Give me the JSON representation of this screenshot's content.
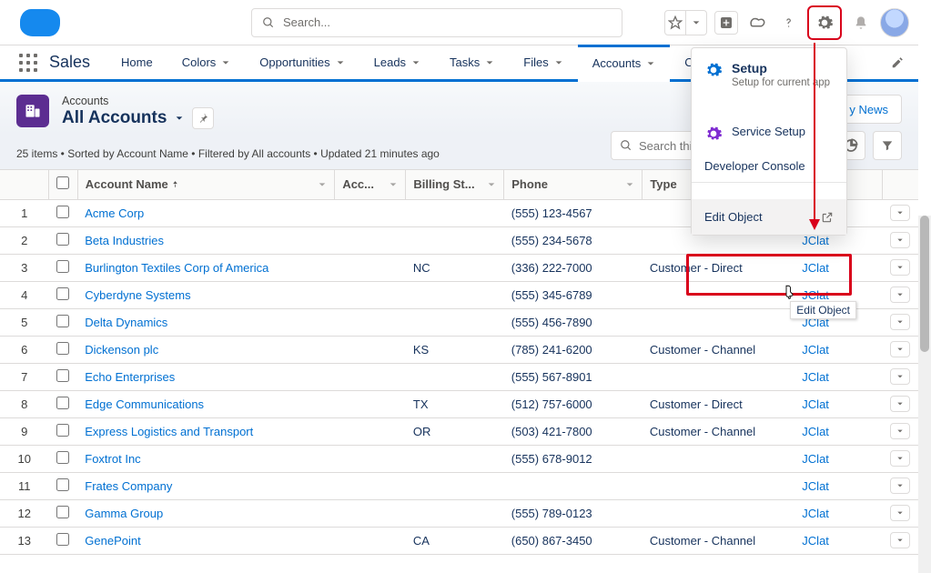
{
  "header": {
    "search_placeholder": "Search..."
  },
  "nav": {
    "app_name": "Sales",
    "items": [
      "Home",
      "Colors",
      "Opportunities",
      "Leads",
      "Tasks",
      "Files",
      "Accounts",
      "C"
    ],
    "active_index": 6
  },
  "page_header": {
    "object_label": "Accounts",
    "listview_name": "All Accounts",
    "meta": "25 items • Sorted by Account Name • Filtered by All accounts • Updated 21 minutes ago",
    "action_button": "y News",
    "list_search_placeholder": "Search this list..."
  },
  "columns": {
    "name": "Account Name",
    "acc": "Acc...",
    "billing": "Billing St...",
    "phone": "Phone",
    "type": "Type",
    "owner": ""
  },
  "rows": [
    {
      "num": "1",
      "name": "Acme Corp",
      "acc": "",
      "billing": "",
      "phone": "(555) 123-4567",
      "type": "",
      "owner": ""
    },
    {
      "num": "2",
      "name": "Beta Industries",
      "acc": "",
      "billing": "",
      "phone": "(555) 234-5678",
      "type": "",
      "owner": "JClat"
    },
    {
      "num": "3",
      "name": "Burlington Textiles Corp of America",
      "acc": "",
      "billing": "NC",
      "phone": "(336) 222-7000",
      "type": "Customer - Direct",
      "owner": "JClat"
    },
    {
      "num": "4",
      "name": "Cyberdyne Systems",
      "acc": "",
      "billing": "",
      "phone": "(555) 345-6789",
      "type": "",
      "owner": "JClat"
    },
    {
      "num": "5",
      "name": "Delta Dynamics",
      "acc": "",
      "billing": "",
      "phone": "(555) 456-7890",
      "type": "",
      "owner": "JClat"
    },
    {
      "num": "6",
      "name": "Dickenson plc",
      "acc": "",
      "billing": "KS",
      "phone": "(785) 241-6200",
      "type": "Customer - Channel",
      "owner": "JClat"
    },
    {
      "num": "7",
      "name": "Echo Enterprises",
      "acc": "",
      "billing": "",
      "phone": "(555) 567-8901",
      "type": "",
      "owner": "JClat"
    },
    {
      "num": "8",
      "name": "Edge Communications",
      "acc": "",
      "billing": "TX",
      "phone": "(512) 757-6000",
      "type": "Customer - Direct",
      "owner": "JClat"
    },
    {
      "num": "9",
      "name": "Express Logistics and Transport",
      "acc": "",
      "billing": "OR",
      "phone": "(503) 421-7800",
      "type": "Customer - Channel",
      "owner": "JClat"
    },
    {
      "num": "10",
      "name": "Foxtrot Inc",
      "acc": "",
      "billing": "",
      "phone": "(555) 678-9012",
      "type": "",
      "owner": "JClat"
    },
    {
      "num": "11",
      "name": "Frates Company",
      "acc": "",
      "billing": "",
      "phone": "",
      "type": "",
      "owner": "JClat"
    },
    {
      "num": "12",
      "name": "Gamma Group",
      "acc": "",
      "billing": "",
      "phone": "(555) 789-0123",
      "type": "",
      "owner": "JClat"
    },
    {
      "num": "13",
      "name": "GenePoint",
      "acc": "",
      "billing": "CA",
      "phone": "(650) 867-3450",
      "type": "Customer - Channel",
      "owner": "JClat"
    }
  ],
  "setup_menu": {
    "setup_title": "Setup",
    "setup_sub": "Setup for current app",
    "service_setup": "Service Setup",
    "developer_console": "Developer Console",
    "edit_object": "Edit Object",
    "tooltip": "Edit Object"
  }
}
